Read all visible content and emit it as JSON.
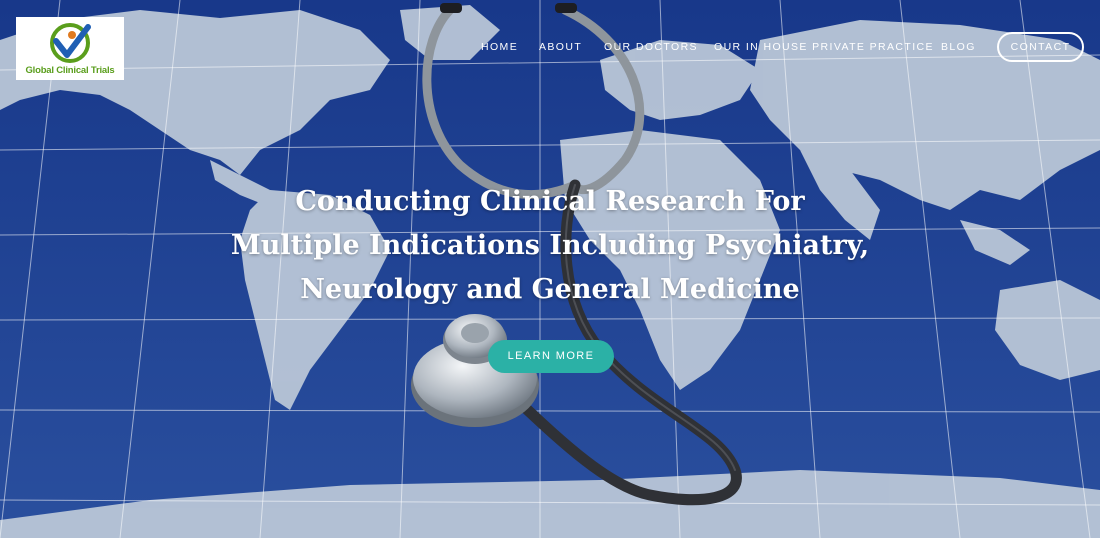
{
  "logo": {
    "text": "Global Clinical Trials",
    "alt": "Global Clinical Trials logo"
  },
  "nav": {
    "items": [
      "HOME",
      "ABOUT",
      "OUR DOCTORS",
      "OUR IN HOUSE PRIVATE PRACTICE",
      "BLOG"
    ],
    "contact_label": "CONTACT"
  },
  "hero": {
    "headline_lines": [
      "Conducting Clinical Research For",
      "Multiple Indications Including Psychiatry,",
      "Neurology and General Medicine"
    ],
    "cta_label": "LEARN MORE"
  },
  "colors": {
    "ocean": "#1c3f8c",
    "land": "#b8c6d8",
    "cta": "#2bb1a6",
    "logo_green": "#5a9e1c",
    "logo_blue": "#1f5fb4"
  }
}
